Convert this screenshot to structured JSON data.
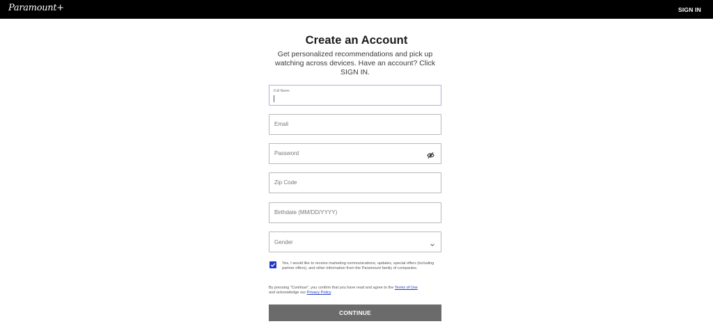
{
  "header": {
    "logo_text": "Paramount+",
    "signin_label": "SIGN IN"
  },
  "form": {
    "title": "Create an Account",
    "subtitle": "Get personalized recommendations and pick up watching across devices. Have an account? Click SIGN IN.",
    "full_name": {
      "label": "Full Name",
      "value": ""
    },
    "email": {
      "placeholder": "Email"
    },
    "password": {
      "placeholder": "Password"
    },
    "zip": {
      "placeholder": "Zip Code"
    },
    "birthdate": {
      "placeholder": "Birthdate (MM/DD/YYYY)"
    },
    "gender": {
      "placeholder": "Gender"
    },
    "consent": {
      "checked": true,
      "text": "Yes, I would like to receive marketing communications, updates, special offers (including partner offers), and other information from the Paramount family of companies."
    },
    "terms": {
      "prefix": "By pressing \"Continue\", you confirm that you have read and agree to the ",
      "terms_link": "Terms of Use",
      "middle": " and acknowledge our ",
      "privacy_link": "Privacy Policy",
      "suffix": "."
    },
    "continue_label": "CONTINUE"
  },
  "icons": {
    "password_toggle": "eye-icon",
    "gender_dropdown": "chevron-down-icon",
    "consent_check": "checkmark-icon"
  },
  "colors": {
    "topbar": "#000000",
    "checkbox": "#1f36c8",
    "continue_button": "#6b6b6b",
    "link": "#2040c0"
  }
}
